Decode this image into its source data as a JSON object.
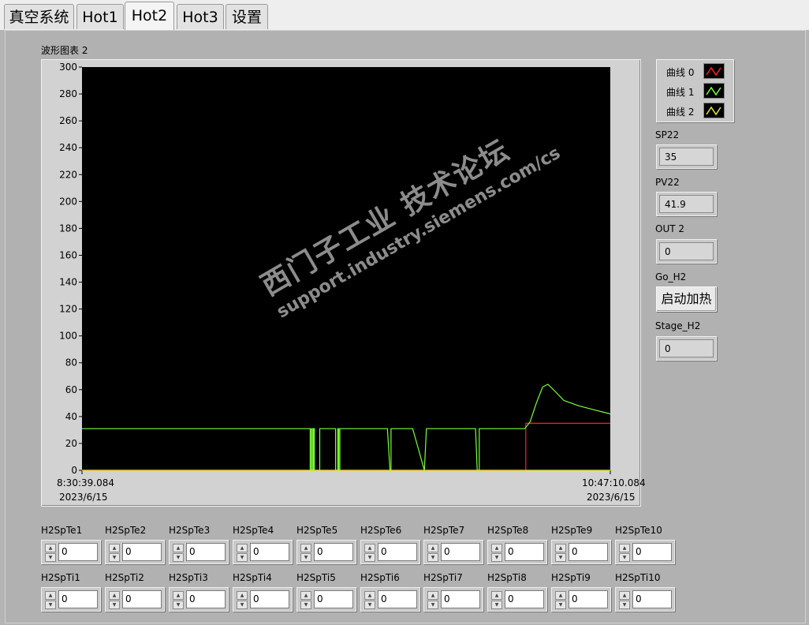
{
  "tabs": [
    {
      "label": "真空系统"
    },
    {
      "label": "Hot1"
    },
    {
      "label": "Hot2"
    },
    {
      "label": "Hot3"
    },
    {
      "label": "设置"
    }
  ],
  "chart": {
    "title": "波形图表 2",
    "x_start_time": "8:30:39.084",
    "x_start_date": "2023/6/15",
    "x_end_time": "10:47:10.084",
    "x_end_date": "2023/6/15"
  },
  "chart_data": {
    "type": "line",
    "ylim": [
      0,
      300
    ],
    "yticks": [
      0,
      20,
      40,
      60,
      80,
      100,
      120,
      140,
      160,
      180,
      200,
      220,
      240,
      260,
      280,
      300
    ],
    "grid": false,
    "x_range": [
      "8:30:39.084 2023/6/15",
      "10:47:10.084 2023/6/15"
    ],
    "x_unit": "fraction of time span",
    "series": [
      {
        "name": "曲线 0",
        "color": "#ff2020",
        "points": [
          [
            0,
            0
          ],
          [
            0.84,
            0
          ],
          [
            0.84,
            35
          ],
          [
            1.0,
            35
          ]
        ]
      },
      {
        "name": "曲线 1",
        "color": "#7aff3a",
        "points": [
          [
            0,
            31
          ],
          [
            0.432,
            31
          ],
          [
            0.432,
            0
          ],
          [
            0.434,
            0
          ],
          [
            0.434,
            31
          ],
          [
            0.436,
            31
          ],
          [
            0.436,
            0
          ],
          [
            0.438,
            0
          ],
          [
            0.438,
            31
          ],
          [
            0.44,
            31
          ],
          [
            0.44,
            0
          ],
          [
            0.45,
            0
          ],
          [
            0.45,
            31
          ],
          [
            0.48,
            31
          ],
          [
            0.48,
            0
          ],
          [
            0.484,
            0
          ],
          [
            0.484,
            31
          ],
          [
            0.486,
            31
          ],
          [
            0.486,
            0
          ],
          [
            0.488,
            0
          ],
          [
            0.488,
            31
          ],
          [
            0.578,
            31
          ],
          [
            0.583,
            0
          ],
          [
            0.585,
            0
          ],
          [
            0.585,
            31
          ],
          [
            0.626,
            31
          ],
          [
            0.648,
            0
          ],
          [
            0.652,
            31
          ],
          [
            0.745,
            31
          ],
          [
            0.748,
            0
          ],
          [
            0.752,
            0
          ],
          [
            0.752,
            31
          ],
          [
            0.838,
            31
          ],
          [
            0.848,
            36
          ],
          [
            0.86,
            50
          ],
          [
            0.872,
            62
          ],
          [
            0.882,
            64
          ],
          [
            0.895,
            59
          ],
          [
            0.912,
            52
          ],
          [
            0.94,
            48
          ],
          [
            0.97,
            45
          ],
          [
            1.0,
            42
          ]
        ]
      },
      {
        "name": "曲线 2",
        "color": "#e6e640",
        "points": [
          [
            0,
            0
          ],
          [
            1.0,
            0
          ]
        ]
      }
    ]
  },
  "legend": [
    {
      "label": "曲线 0",
      "color": "#ff2020"
    },
    {
      "label": "曲线 1",
      "color": "#7aff3a"
    },
    {
      "label": "曲线 2",
      "color": "#e6e640"
    }
  ],
  "indicators": {
    "sp22": {
      "label": "SP22",
      "value": "35"
    },
    "pv22": {
      "label": "PV22",
      "value": "41.9"
    },
    "out2": {
      "label": "OUT 2",
      "value": "0"
    },
    "go_h2": {
      "label": "Go_H2",
      "button": "启动加热"
    },
    "stage_h2": {
      "label": "Stage_H2",
      "value": "0"
    }
  },
  "te_controls": [
    {
      "label": "H2SpTe1",
      "value": "0"
    },
    {
      "label": "H2SpTe2",
      "value": "0"
    },
    {
      "label": "H2SpTe3",
      "value": "0"
    },
    {
      "label": "H2SpTe4",
      "value": "0"
    },
    {
      "label": "H2SpTe5",
      "value": "0"
    },
    {
      "label": "H2SpTe6",
      "value": "0"
    },
    {
      "label": "H2SpTe7",
      "value": "0"
    },
    {
      "label": "H2SpTe8",
      "value": "0"
    },
    {
      "label": "H2SpTe9",
      "value": "0"
    },
    {
      "label": "H2SpTe10",
      "value": "0"
    }
  ],
  "ti_controls": [
    {
      "label": "H2SpTi1",
      "value": "0"
    },
    {
      "label": "H2SpTi2",
      "value": "0"
    },
    {
      "label": "H2SpTi3",
      "value": "0"
    },
    {
      "label": "H2SpTi4",
      "value": "0"
    },
    {
      "label": "H2SpTi5",
      "value": "0"
    },
    {
      "label": "H2SpTi6",
      "value": "0"
    },
    {
      "label": "H2SpTi7",
      "value": "0"
    },
    {
      "label": "H2SpTi8",
      "value": "0"
    },
    {
      "label": "H2SpTi9",
      "value": "0"
    },
    {
      "label": "H2SpTi10",
      "value": "0"
    }
  ],
  "watermark": {
    "line1": "西门子工业 技术论坛",
    "line2": "support.industry.siemens.com/cs"
  }
}
